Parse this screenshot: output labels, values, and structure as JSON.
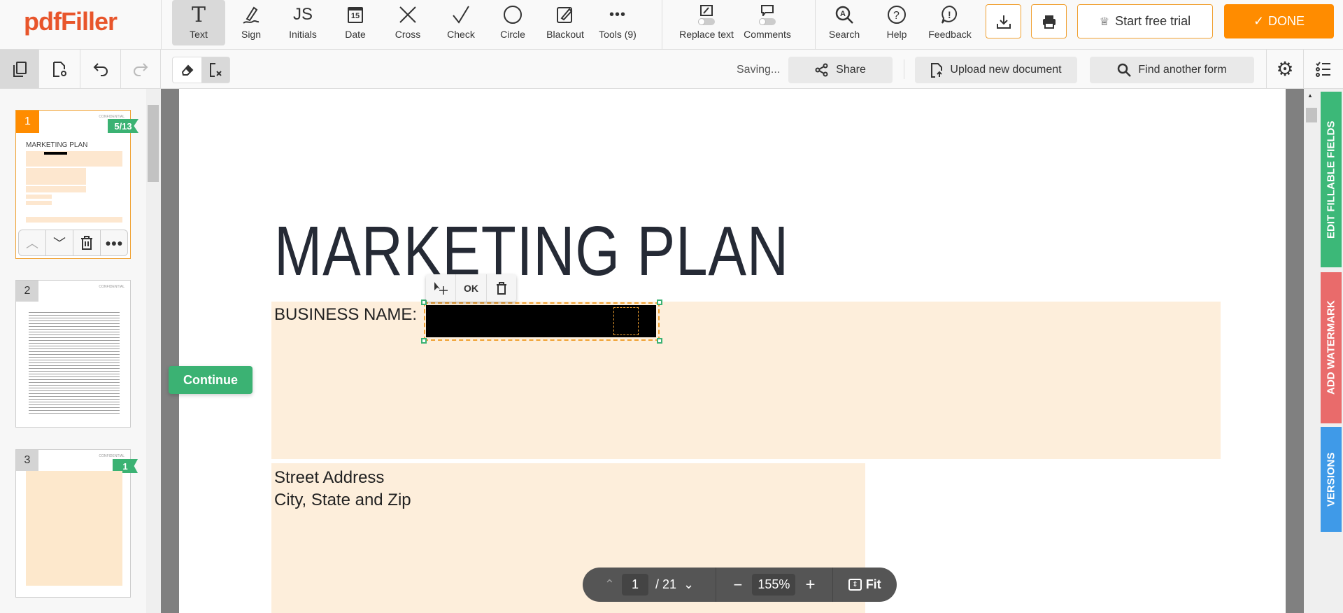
{
  "app": {
    "logo": "pdfFiller",
    "accent": "#ff8c00",
    "logo_color": "#e8552b"
  },
  "toolbar": {
    "tools": [
      {
        "label": "Text",
        "icon": "text-icon",
        "active": true
      },
      {
        "label": "Sign",
        "icon": "sign-icon"
      },
      {
        "label": "Initials",
        "icon": "initials-icon"
      },
      {
        "label": "Date",
        "icon": "calendar-icon"
      },
      {
        "label": "Cross",
        "icon": "cross-icon"
      },
      {
        "label": "Check",
        "icon": "check-icon"
      },
      {
        "label": "Circle",
        "icon": "circle-icon"
      },
      {
        "label": "Blackout",
        "icon": "blackout-icon"
      },
      {
        "label": "Tools (9)",
        "icon": "more-icon"
      }
    ],
    "initials_glyph": "JS",
    "date_glyph": "15",
    "replace_text": "Replace text",
    "comments": "Comments",
    "search": "Search",
    "help": "Help",
    "feedback": "Feedback",
    "start_trial": "Start free trial",
    "done": "DONE"
  },
  "subbar": {
    "status": "Saving...",
    "share": "Share",
    "upload": "Upload new document",
    "find": "Find another form"
  },
  "thumbnails": [
    {
      "num": "1",
      "badge": "5/13",
      "title": "MARKETING PLAN",
      "confidential": "CONFIDENTIAL",
      "active": true
    },
    {
      "num": "2",
      "confidential": "CONFIDENTIAL"
    },
    {
      "num": "3",
      "badge": "1",
      "confidential": "CONFIDENTIAL"
    }
  ],
  "continue": "Continue",
  "document": {
    "title": "MARKETING PLAN",
    "business_label": "BUSINESS NAME:",
    "address_line1": "Street Address",
    "address_line2": "City, State and Zip",
    "field_color": "#fdeedb"
  },
  "field_toolbar": {
    "ok": "OK"
  },
  "pager": {
    "page": "1",
    "total": "/ 21",
    "zoom": "155%",
    "fit": "Fit"
  },
  "right_tabs": [
    {
      "label": "EDIT FILLABLE FIELDS",
      "color": "#3cb878"
    },
    {
      "label": "ADD WATERMARK",
      "color": "#e96b6b"
    },
    {
      "label": "VERSIONS",
      "color": "#3f9ae8"
    }
  ]
}
